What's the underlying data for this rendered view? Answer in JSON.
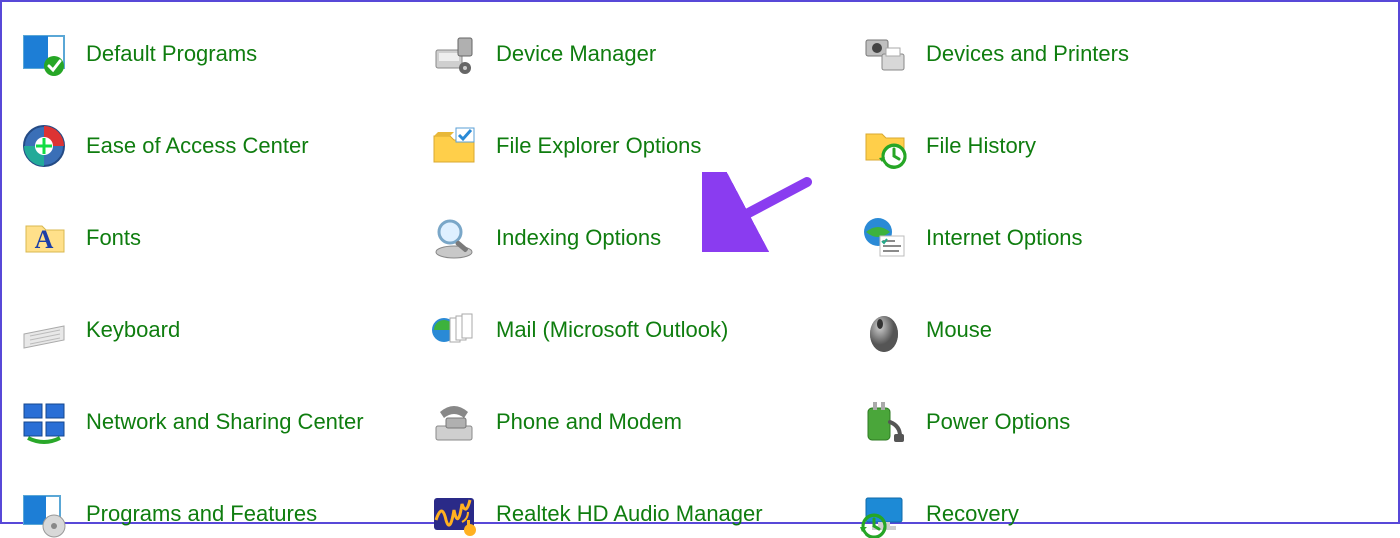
{
  "items": [
    {
      "key": "default-programs",
      "label": "Default Programs",
      "icon": "default-programs-icon"
    },
    {
      "key": "device-manager",
      "label": "Device Manager",
      "icon": "device-manager-icon"
    },
    {
      "key": "devices-printers",
      "label": "Devices and Printers",
      "icon": "devices-printers-icon"
    },
    {
      "key": "ease-of-access",
      "label": "Ease of Access Center",
      "icon": "ease-of-access-icon"
    },
    {
      "key": "file-explorer-options",
      "label": "File Explorer Options",
      "icon": "file-explorer-options-icon"
    },
    {
      "key": "file-history",
      "label": "File History",
      "icon": "file-history-icon"
    },
    {
      "key": "fonts",
      "label": "Fonts",
      "icon": "fonts-icon"
    },
    {
      "key": "indexing-options",
      "label": "Indexing Options",
      "icon": "indexing-options-icon"
    },
    {
      "key": "internet-options",
      "label": "Internet Options",
      "icon": "internet-options-icon"
    },
    {
      "key": "keyboard",
      "label": "Keyboard",
      "icon": "keyboard-icon"
    },
    {
      "key": "mail-outlook",
      "label": "Mail (Microsoft Outlook)",
      "icon": "mail-outlook-icon"
    },
    {
      "key": "mouse",
      "label": "Mouse",
      "icon": "mouse-icon"
    },
    {
      "key": "network-sharing",
      "label": "Network and Sharing Center",
      "icon": "network-sharing-icon"
    },
    {
      "key": "phone-modem",
      "label": "Phone and Modem",
      "icon": "phone-modem-icon"
    },
    {
      "key": "power-options",
      "label": "Power Options",
      "icon": "power-options-icon"
    },
    {
      "key": "programs-features",
      "label": "Programs and Features",
      "icon": "programs-features-icon"
    },
    {
      "key": "realtek-audio",
      "label": "Realtek HD Audio Manager",
      "icon": "realtek-audio-icon"
    },
    {
      "key": "recovery",
      "label": "Recovery",
      "icon": "recovery-icon"
    }
  ],
  "annotation": {
    "arrow_target": "indexing-options",
    "arrow_color": "#8a3cf0"
  }
}
